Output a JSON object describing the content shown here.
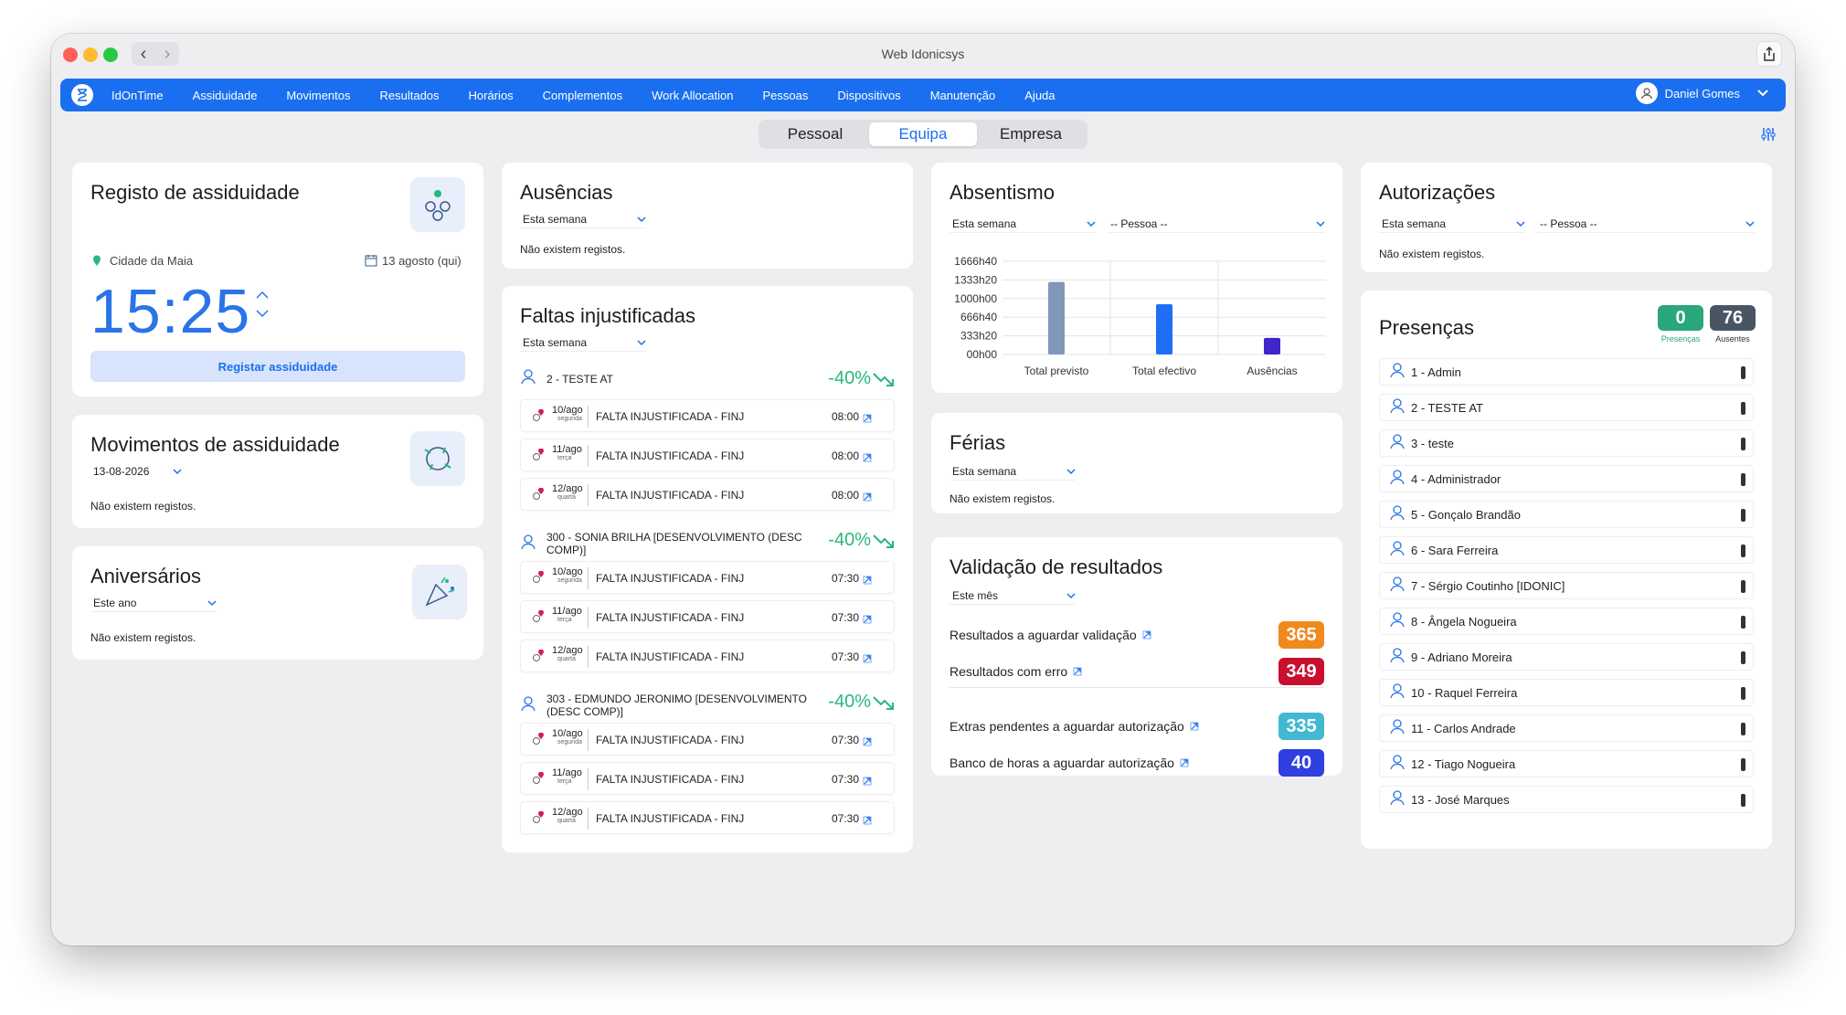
{
  "window": {
    "title": "Web Idonicsys"
  },
  "nav": {
    "items": [
      "IdOnTime",
      "Assiduidade",
      "Movimentos",
      "Resultados",
      "Horários",
      "Complementos",
      "Work Allocation",
      "Pessoas",
      "Dispositivos",
      "Manutenção",
      "Ajuda"
    ],
    "user": "Daniel Gomes"
  },
  "tabs": [
    "Pessoal",
    "Equipa",
    "Empresa"
  ],
  "registo": {
    "title": "Registo de assiduidade",
    "location": "Cidade da Maia",
    "date": "13 agosto (qui)",
    "time": "15:25",
    "button": "Registar assiduidade"
  },
  "movimentos": {
    "title": "Movimentos de assiduidade",
    "date": "13-08-2026",
    "empty": "Não existem registos."
  },
  "aniversarios": {
    "title": "Aniversários",
    "period": "Este ano",
    "empty": "Não existem registos."
  },
  "ausencias": {
    "title": "Ausências",
    "period": "Esta semana",
    "empty": "Não existem registos."
  },
  "faltas": {
    "title": "Faltas injustificadas",
    "period": "Esta semana",
    "groups": [
      {
        "person": "2 - TESTE AT",
        "pct": "-40%",
        "entries": [
          {
            "day": "10/ago",
            "weekday": "segunda",
            "desc": "FALTA INJUSTIFICADA - FINJ",
            "time": "08:00"
          },
          {
            "day": "11/ago",
            "weekday": "terça",
            "desc": "FALTA INJUSTIFICADA - FINJ",
            "time": "08:00"
          },
          {
            "day": "12/ago",
            "weekday": "quarta",
            "desc": "FALTA INJUSTIFICADA - FINJ",
            "time": "08:00"
          }
        ]
      },
      {
        "person": "300 - SONIA BRILHA [DESENVOLVIMENTO (DESC COMP)]",
        "pct": "-40%",
        "entries": [
          {
            "day": "10/ago",
            "weekday": "segunda",
            "desc": "FALTA INJUSTIFICADA - FINJ",
            "time": "07:30"
          },
          {
            "day": "11/ago",
            "weekday": "terça",
            "desc": "FALTA INJUSTIFICADA - FINJ",
            "time": "07:30"
          },
          {
            "day": "12/ago",
            "weekday": "quarta",
            "desc": "FALTA INJUSTIFICADA - FINJ",
            "time": "07:30"
          }
        ]
      },
      {
        "person": "303 - EDMUNDO JERONIMO [DESENVOLVIMENTO (DESC COMP)]",
        "pct": "-40%",
        "entries": [
          {
            "day": "10/ago",
            "weekday": "segunda",
            "desc": "FALTA INJUSTIFICADA - FINJ",
            "time": "07:30"
          },
          {
            "day": "11/ago",
            "weekday": "terça",
            "desc": "FALTA INJUSTIFICADA - FINJ",
            "time": "07:30"
          },
          {
            "day": "12/ago",
            "weekday": "quarta",
            "desc": "FALTA INJUSTIFICADA - FINJ",
            "time": "07:30"
          }
        ]
      }
    ]
  },
  "absentismo": {
    "title": "Absentismo",
    "period": "Esta semana",
    "person": "-- Pessoa --"
  },
  "chart_data": {
    "type": "bar",
    "categories": [
      "Total previsto",
      "Total efectivo",
      "Ausências"
    ],
    "values": [
      1296,
      898,
      296
    ],
    "value_unit": "hours (approx.)",
    "tick_labels": [
      "1666h40",
      "1333h20",
      "1000h00",
      "666h40",
      "333h20",
      "00h00"
    ],
    "ylim": [
      0,
      1666.67
    ],
    "colors": [
      "#7f97b9",
      "#1f6ef5",
      "#4025c8"
    ],
    "grid": true
  },
  "ferias": {
    "title": "Férias",
    "period": "Esta semana",
    "empty": "Não existem registos."
  },
  "validacao": {
    "title": "Validação de resultados",
    "period": "Este mês",
    "rows": [
      {
        "label": "Resultados a aguardar validação",
        "value": "365",
        "color": "#f08a1f"
      },
      {
        "label": "Resultados com erro",
        "value": "349",
        "color": "#c8102e"
      },
      {
        "label": "Extras pendentes a aguardar autorização",
        "value": "335",
        "color": "#42b8d1"
      },
      {
        "label": "Banco de horas a aguardar autorização",
        "value": "40",
        "color": "#2f3fe0"
      }
    ]
  },
  "autorizacoes": {
    "title": "Autorizações",
    "period": "Esta semana",
    "person": "-- Pessoa --",
    "empty": "Não existem registos."
  },
  "presencas": {
    "title": "Presenças",
    "present_count": "0",
    "present_label": "Presenças",
    "present_color": "#2aa77b",
    "absent_count": "76",
    "absent_label": "Ausentes",
    "absent_color": "#4a5563",
    "people": [
      "1 - Admin",
      "2 - TESTE AT",
      "3 - teste",
      "4 - Administrador",
      "5 - Gonçalo Brandão",
      "6 - Sara Ferreira",
      "7 - Sérgio Coutinho [IDONIC]",
      "8 - Ângela Nogueira",
      "9 - Adriano Moreira",
      "10 - Raquel Ferreira",
      "11 - Carlos Andrade",
      "12 - Tiago Nogueira",
      "13 - José Marques"
    ]
  }
}
